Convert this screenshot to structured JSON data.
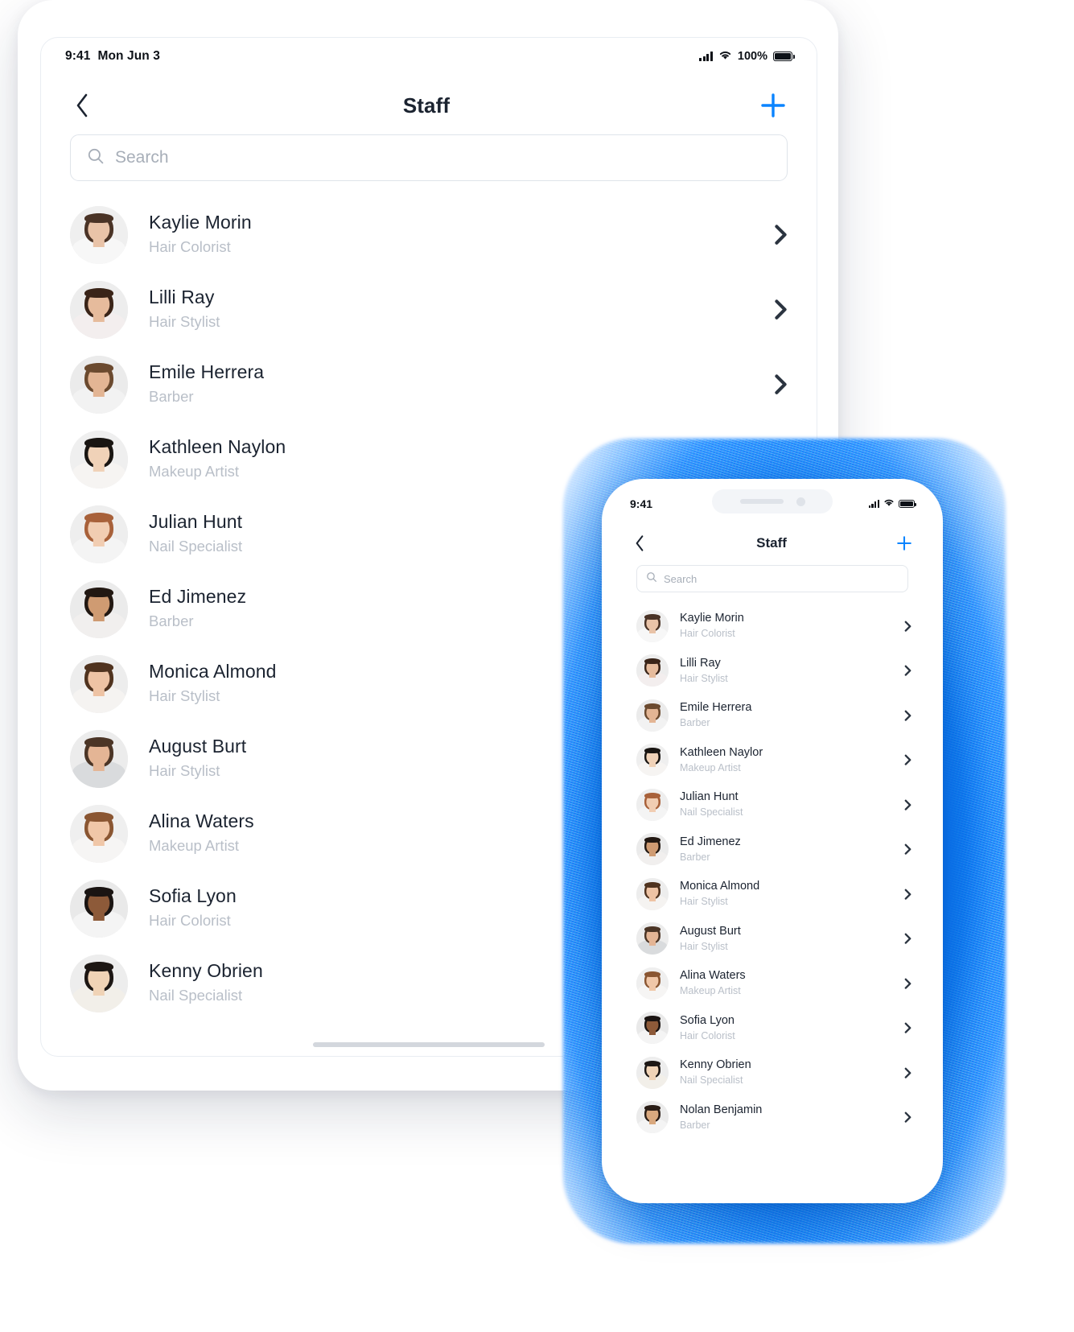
{
  "accent_color": "#0a84ff",
  "tablet": {
    "status_bar": {
      "time": "9:41",
      "date": "Mon Jun 3",
      "battery_percent": "100%"
    },
    "nav": {
      "back_label": "Back",
      "title": "Staff",
      "add_label": "Add staff"
    },
    "search": {
      "placeholder": "Search",
      "value": ""
    },
    "staff": [
      {
        "name": "Kaylie Morin",
        "role": "Hair Colorist",
        "skin": "#e9c3a8",
        "hair": "#4a3326",
        "shirt": "#f7f7f7",
        "bg": "#efefef"
      },
      {
        "name": "Lilli Ray",
        "role": "Hair Stylist",
        "skin": "#e6bb9c",
        "hair": "#3a2418",
        "shirt": "#f3eeee",
        "bg": "#ededed"
      },
      {
        "name": "Emile Herrera",
        "role": "Barber",
        "skin": "#e3b594",
        "hair": "#6b4a2f",
        "shirt": "#f2f2f2",
        "bg": "#ebebeb"
      },
      {
        "name": "Kathleen Naylon",
        "role": "Makeup Artist",
        "skin": "#f0d2b8",
        "hair": "#191512",
        "shirt": "#f6f4f2",
        "bg": "#efefef"
      },
      {
        "name": "Julian Hunt",
        "role": "Nail Specialist",
        "skin": "#f1cdb2",
        "hair": "#a8613a",
        "shirt": "#f4f4f4",
        "bg": "#eeeeee"
      },
      {
        "name": "Ed Jimenez",
        "role": "Barber",
        "skin": "#cf9b72",
        "hair": "#221812",
        "shirt": "#f1efee",
        "bg": "#ebebeb"
      },
      {
        "name": "Monica Almond",
        "role": "Hair Stylist",
        "skin": "#eec3a4",
        "hair": "#50331f",
        "shirt": "#f5f3f1",
        "bg": "#ededed"
      },
      {
        "name": "August Burt",
        "role": "Hair Stylist",
        "skin": "#e4b595",
        "hair": "#4b3526",
        "shirt": "#d9dbdd",
        "bg": "#ececec"
      },
      {
        "name": "Alina Waters",
        "role": "Makeup Artist",
        "skin": "#f0c7a8",
        "hair": "#8a5632",
        "shirt": "#f6f5f4",
        "bg": "#efefef"
      },
      {
        "name": "Sofia Lyon",
        "role": "Hair Colorist",
        "skin": "#8d5a39",
        "hair": "#1a1412",
        "shirt": "#f4f4f4",
        "bg": "#e9e9e9"
      },
      {
        "name": "Kenny Obrien",
        "role": "Nail Specialist",
        "skin": "#f0d3b6",
        "hair": "#1d1714",
        "shirt": "#f2efe9",
        "bg": "#ededed"
      }
    ]
  },
  "phone": {
    "status_bar": {
      "time": "9:41"
    },
    "nav": {
      "back_label": "Back",
      "title": "Staff",
      "add_label": "Add staff"
    },
    "search": {
      "placeholder": "Search",
      "value": ""
    },
    "staff": [
      {
        "name": "Kaylie Morin",
        "role": "Hair Colorist",
        "skin": "#e9c3a8",
        "hair": "#4a3326",
        "shirt": "#f7f7f7",
        "bg": "#efefef"
      },
      {
        "name": "Lilli Ray",
        "role": "Hair Stylist",
        "skin": "#e6bb9c",
        "hair": "#3a2418",
        "shirt": "#f3eeee",
        "bg": "#ededed"
      },
      {
        "name": "Emile Herrera",
        "role": "Barber",
        "skin": "#e3b594",
        "hair": "#6b4a2f",
        "shirt": "#f2f2f2",
        "bg": "#ebebeb"
      },
      {
        "name": "Kathleen Naylor",
        "role": "Makeup Artist",
        "skin": "#f0d2b8",
        "hair": "#191512",
        "shirt": "#f6f4f2",
        "bg": "#efefef"
      },
      {
        "name": "Julian Hunt",
        "role": "Nail Specialist",
        "skin": "#f1cdb2",
        "hair": "#a8613a",
        "shirt": "#f4f4f4",
        "bg": "#eeeeee"
      },
      {
        "name": "Ed Jimenez",
        "role": "Barber",
        "skin": "#cf9b72",
        "hair": "#221812",
        "shirt": "#f1efee",
        "bg": "#ebebeb"
      },
      {
        "name": "Monica Almond",
        "role": "Hair Stylist",
        "skin": "#eec3a4",
        "hair": "#50331f",
        "shirt": "#f5f3f1",
        "bg": "#ededed"
      },
      {
        "name": "August Burt",
        "role": "Hair Stylist",
        "skin": "#e4b595",
        "hair": "#4b3526",
        "shirt": "#d9dbdd",
        "bg": "#ececec"
      },
      {
        "name": "Alina Waters",
        "role": "Makeup Artist",
        "skin": "#f0c7a8",
        "hair": "#8a5632",
        "shirt": "#f6f5f4",
        "bg": "#efefef"
      },
      {
        "name": "Sofia Lyon",
        "role": "Hair Colorist",
        "skin": "#8d5a39",
        "hair": "#1a1412",
        "shirt": "#f4f4f4",
        "bg": "#e9e9e9"
      },
      {
        "name": "Kenny Obrien",
        "role": "Nail Specialist",
        "skin": "#f0d3b6",
        "hair": "#1d1714",
        "shirt": "#f2efe9",
        "bg": "#ededed"
      },
      {
        "name": "Nolan Benjamin",
        "role": "Barber",
        "skin": "#d9a87e",
        "hair": "#2a1d16",
        "shirt": "#f4f4f4",
        "bg": "#ebebeb"
      }
    ]
  }
}
